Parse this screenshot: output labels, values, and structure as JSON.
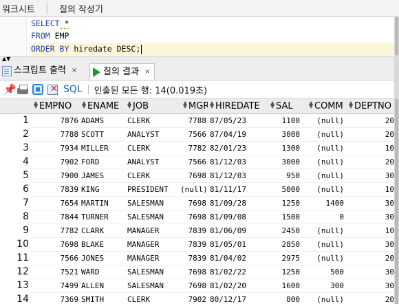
{
  "editor_tabs": [
    "워크시트",
    "질의 작성기"
  ],
  "sql_lines": [
    {
      "kw": "SELECT",
      "rest": " *"
    },
    {
      "kw": "FROM",
      "rest": " EMP"
    },
    {
      "kw": "ORDER BY",
      "rest": " hiredate DESC;"
    }
  ],
  "output_tabs": [
    {
      "label": "스크립트 출력",
      "icon": "script-output-icon",
      "close": "×"
    },
    {
      "label": "질의 결과",
      "icon": "run-icon",
      "close": "×"
    }
  ],
  "toolbar": {
    "sql_label": "SQL",
    "status": "인출된 모든 행: 14(0.019초)"
  },
  "columns": [
    "EMPNO",
    "ENAME",
    "JOB",
    "MGR",
    "HIREDATE",
    "SAL",
    "COMM",
    "DEPTNO"
  ],
  "rows": [
    [
      "1",
      "7876",
      "ADAMS",
      "CLERK",
      "7788",
      "87/05/23",
      "1100",
      "(null)",
      "20"
    ],
    [
      "2",
      "7788",
      "SCOTT",
      "ANALYST",
      "7566",
      "87/04/19",
      "3000",
      "(null)",
      "20"
    ],
    [
      "3",
      "7934",
      "MILLER",
      "CLERK",
      "7782",
      "82/01/23",
      "1300",
      "(null)",
      "10"
    ],
    [
      "4",
      "7902",
      "FORD",
      "ANALYST",
      "7566",
      "81/12/03",
      "3000",
      "(null)",
      "20"
    ],
    [
      "5",
      "7900",
      "JAMES",
      "CLERK",
      "7698",
      "81/12/03",
      "950",
      "(null)",
      "30"
    ],
    [
      "6",
      "7839",
      "KING",
      "PRESIDENT",
      "(null)",
      "81/11/17",
      "5000",
      "(null)",
      "10"
    ],
    [
      "7",
      "7654",
      "MARTIN",
      "SALESMAN",
      "7698",
      "81/09/28",
      "1250",
      "1400",
      "30"
    ],
    [
      "8",
      "7844",
      "TURNER",
      "SALESMAN",
      "7698",
      "81/09/08",
      "1500",
      "0",
      "30"
    ],
    [
      "9",
      "7782",
      "CLARK",
      "MANAGER",
      "7839",
      "81/06/09",
      "2450",
      "(null)",
      "10"
    ],
    [
      "10",
      "7698",
      "BLAKE",
      "MANAGER",
      "7839",
      "81/05/01",
      "2850",
      "(null)",
      "30"
    ],
    [
      "11",
      "7566",
      "JONES",
      "MANAGER",
      "7839",
      "81/04/02",
      "2975",
      "(null)",
      "20"
    ],
    [
      "12",
      "7521",
      "WARD",
      "SALESMAN",
      "7698",
      "81/02/22",
      "1250",
      "500",
      "30"
    ],
    [
      "13",
      "7499",
      "ALLEN",
      "SALESMAN",
      "7698",
      "81/02/20",
      "1600",
      "300",
      "30"
    ],
    [
      "14",
      "7369",
      "SMITH",
      "CLERK",
      "7902",
      "80/12/17",
      "800",
      "(null)",
      "20"
    ]
  ]
}
